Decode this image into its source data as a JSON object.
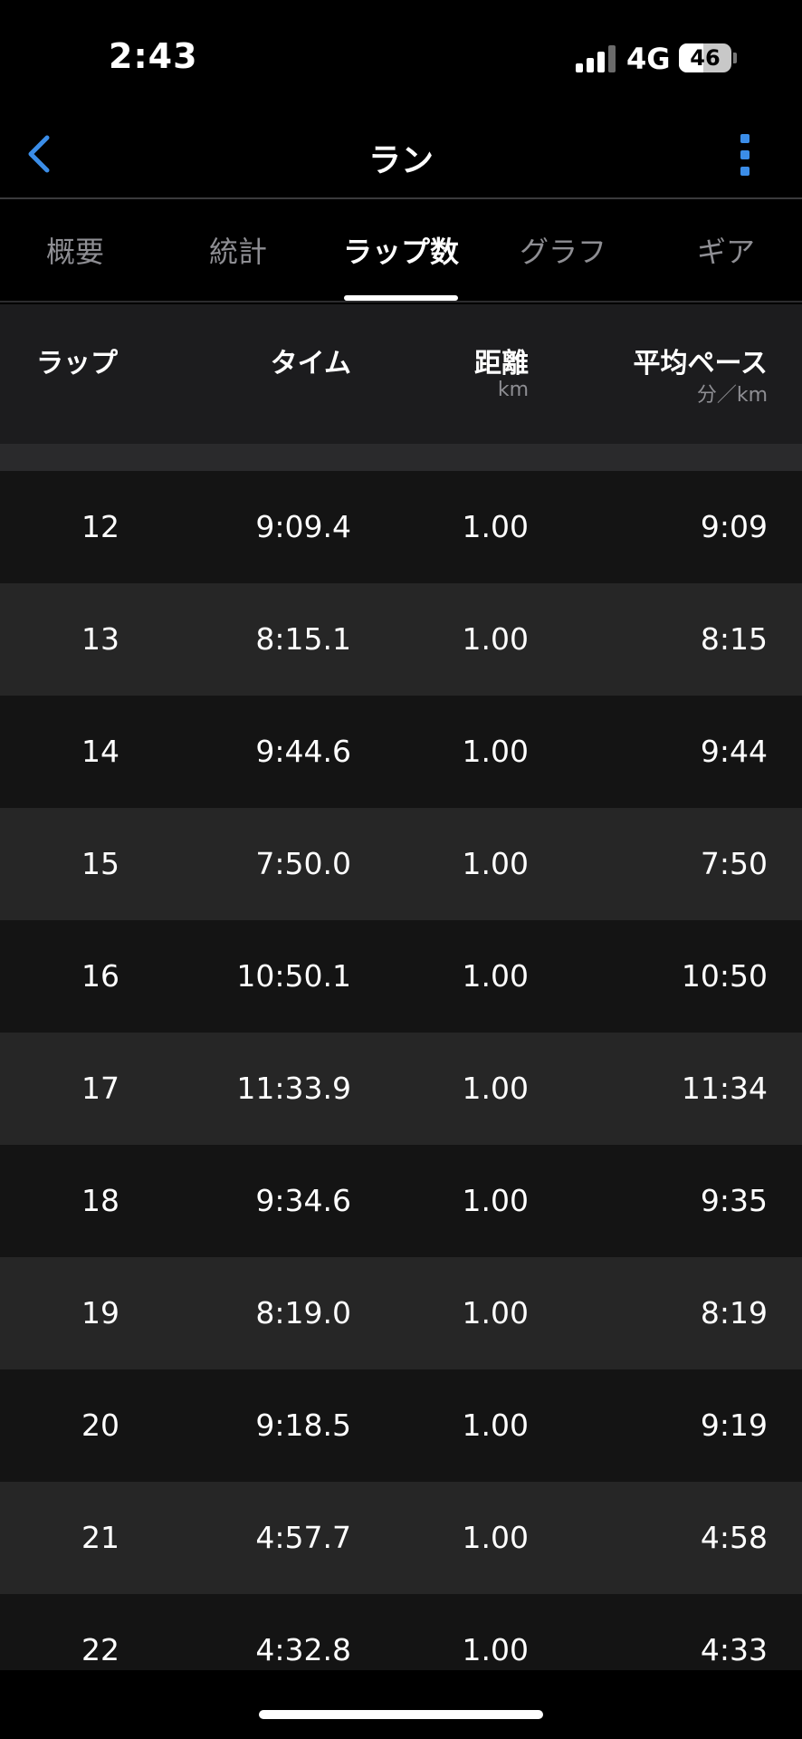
{
  "status_bar": {
    "time": "2:43",
    "network": "4G",
    "battery": "46",
    "battery_level": 0.46
  },
  "nav": {
    "title": "ラン",
    "back_icon": "chevron-left-icon",
    "more_icon": "vertical-ellipsis-icon",
    "accent_color": "#3b8de8"
  },
  "tabs": [
    {
      "label": "概要",
      "active": false
    },
    {
      "label": "統計",
      "active": false
    },
    {
      "label": "ラップ数",
      "active": true
    },
    {
      "label": "グラフ",
      "active": false
    },
    {
      "label": "ギア",
      "active": false
    }
  ],
  "table": {
    "headers": {
      "lap": "ラップ",
      "time": "タイム",
      "distance": "距離",
      "distance_unit": "km",
      "pace": "平均ペース",
      "pace_unit": "分／km"
    },
    "rows": [
      {
        "lap": "12",
        "time": "9:09.4",
        "distance": "1.00",
        "pace": "9:09"
      },
      {
        "lap": "13",
        "time": "8:15.1",
        "distance": "1.00",
        "pace": "8:15"
      },
      {
        "lap": "14",
        "time": "9:44.6",
        "distance": "1.00",
        "pace": "9:44"
      },
      {
        "lap": "15",
        "time": "7:50.0",
        "distance": "1.00",
        "pace": "7:50"
      },
      {
        "lap": "16",
        "time": "10:50.1",
        "distance": "1.00",
        "pace": "10:50"
      },
      {
        "lap": "17",
        "time": "11:33.9",
        "distance": "1.00",
        "pace": "11:34"
      },
      {
        "lap": "18",
        "time": "9:34.6",
        "distance": "1.00",
        "pace": "9:35"
      },
      {
        "lap": "19",
        "time": "8:19.0",
        "distance": "1.00",
        "pace": "8:19"
      },
      {
        "lap": "20",
        "time": "9:18.5",
        "distance": "1.00",
        "pace": "9:19"
      },
      {
        "lap": "21",
        "time": "4:57.7",
        "distance": "1.00",
        "pace": "4:58"
      },
      {
        "lap": "22",
        "time": "4:32.8",
        "distance": "1.00",
        "pace": "4:33"
      }
    ]
  }
}
